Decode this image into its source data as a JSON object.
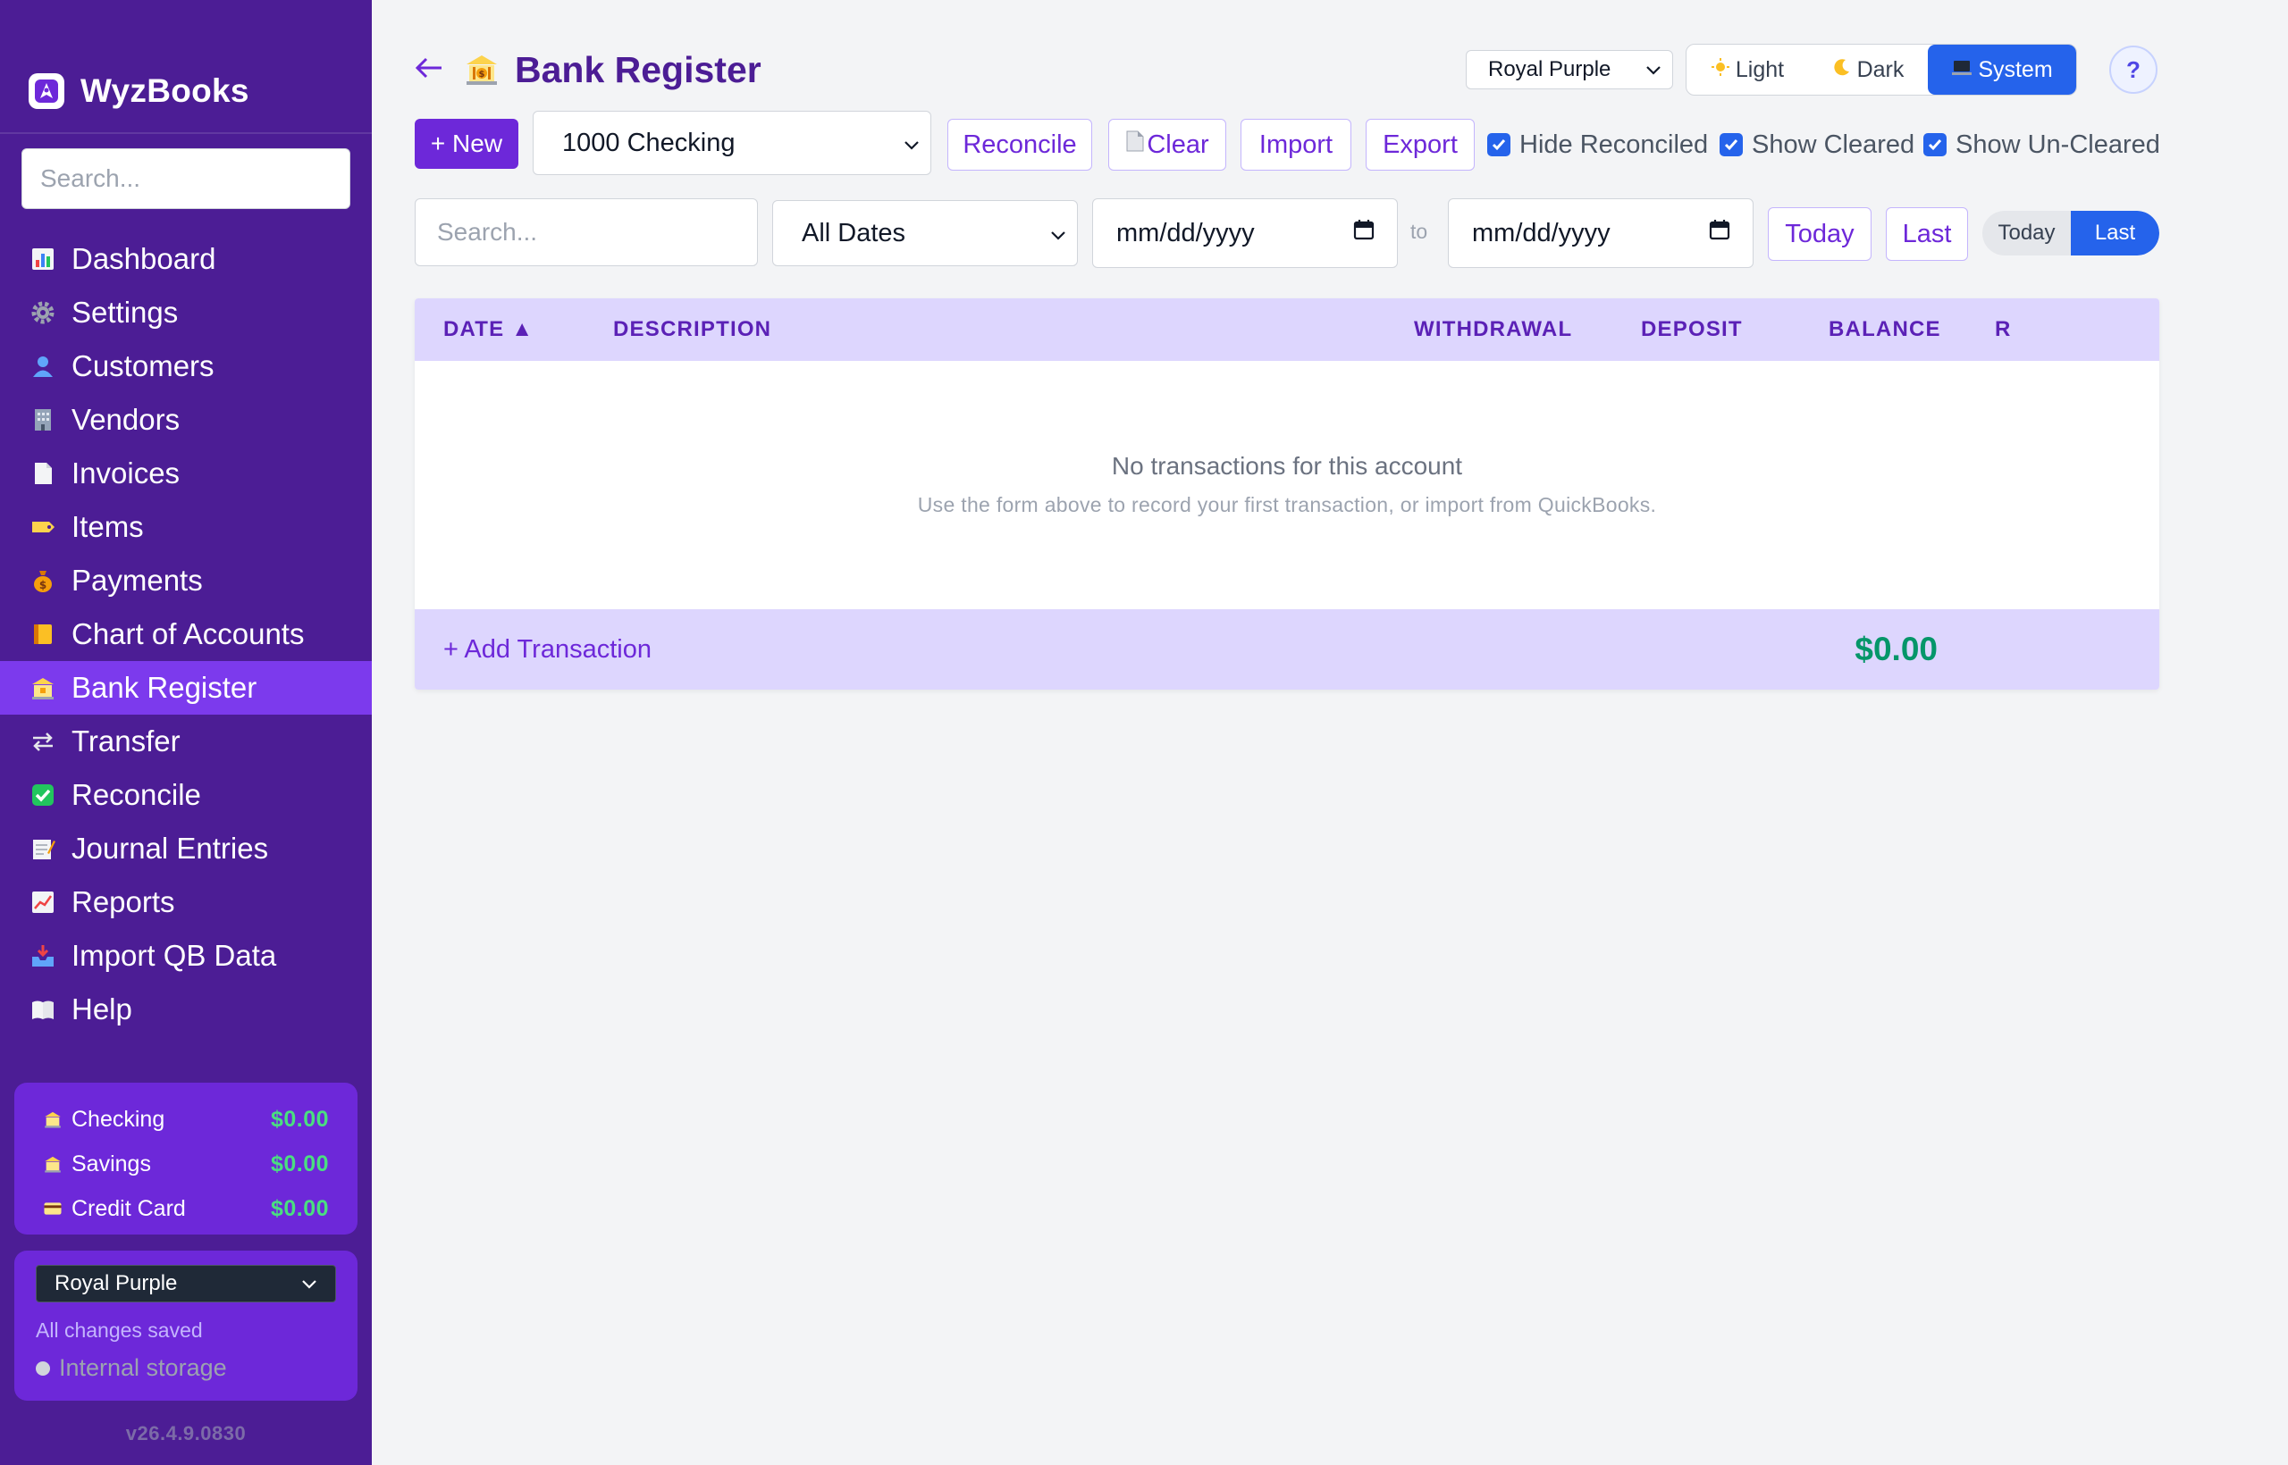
{
  "sidebar": {
    "brand": "WyzBooks",
    "search_placeholder": "Search...",
    "items": [
      {
        "label": "Dashboard",
        "icon": "bar-chart-icon"
      },
      {
        "label": "Settings",
        "icon": "gear-icon"
      },
      {
        "label": "Customers",
        "icon": "person-icon"
      },
      {
        "label": "Vendors",
        "icon": "building-icon"
      },
      {
        "label": "Invoices",
        "icon": "document-icon"
      },
      {
        "label": "Items",
        "icon": "tag-icon"
      },
      {
        "label": "Payments",
        "icon": "money-bag-icon"
      },
      {
        "label": "Chart of Accounts",
        "icon": "ledger-icon"
      },
      {
        "label": "Bank Register",
        "icon": "bank-icon",
        "active": true
      },
      {
        "label": "Transfer",
        "icon": "transfer-arrows-icon"
      },
      {
        "label": "Reconcile",
        "icon": "check-box-icon"
      },
      {
        "label": "Journal Entries",
        "icon": "memo-icon"
      },
      {
        "label": "Reports",
        "icon": "trend-chart-icon"
      },
      {
        "label": "Import QB Data",
        "icon": "inbox-tray-icon"
      },
      {
        "label": "Help",
        "icon": "book-icon"
      }
    ],
    "balances": [
      {
        "label": "Checking",
        "value": "$0.00",
        "icon": "bank-icon"
      },
      {
        "label": "Savings",
        "value": "$0.00",
        "icon": "bank-icon"
      },
      {
        "label": "Credit Card",
        "value": "$0.00",
        "icon": "credit-card-icon"
      }
    ],
    "theme_select": "Royal Purple",
    "saved_status": "All changes saved",
    "storage": "Internal storage",
    "version": "v26.4.9.0830"
  },
  "header": {
    "title": "Bank Register",
    "theme": "Royal Purple",
    "modes": [
      {
        "label": "Light",
        "icon": "sun-icon"
      },
      {
        "label": "Dark",
        "icon": "moon-icon"
      },
      {
        "label": "System",
        "icon": "laptop-icon",
        "active": true
      }
    ],
    "help": "?"
  },
  "toolbar": {
    "new_label": "+ New",
    "account": "1000 Checking",
    "reconcile": "Reconcile",
    "clear": "Clear",
    "import": "Import",
    "export": "Export",
    "checkboxes": [
      {
        "label": "Hide Reconciled",
        "checked": true
      },
      {
        "label": "Show Cleared",
        "checked": true
      },
      {
        "label": "Show Un-Cleared",
        "checked": true
      }
    ]
  },
  "filters": {
    "search_placeholder": "Search...",
    "date_range": "All Dates",
    "from_placeholder": "mm/dd/yyyy",
    "to_label": "to",
    "to_placeholder": "mm/dd/yyyy",
    "today": "Today",
    "last": "Last",
    "toggle": [
      {
        "label": "Today",
        "active": false
      },
      {
        "label": "Last",
        "active": true
      }
    ]
  },
  "table": {
    "columns": [
      "DATE ▲",
      "DESCRIPTION",
      "WITHDRAWAL",
      "DEPOSIT",
      "BALANCE",
      "R"
    ],
    "empty_title": "No transactions for this account",
    "empty_subtitle": "Use the form above to record your first transaction, or import from QuickBooks.",
    "add_label": "+ Add Transaction",
    "total": "$0.00"
  },
  "colors": {
    "sidebar_bg": "#4c1d95",
    "accent": "#6d28d9",
    "active_nav": "#7c3aed",
    "blue": "#2563eb",
    "money_green": "#059669"
  }
}
